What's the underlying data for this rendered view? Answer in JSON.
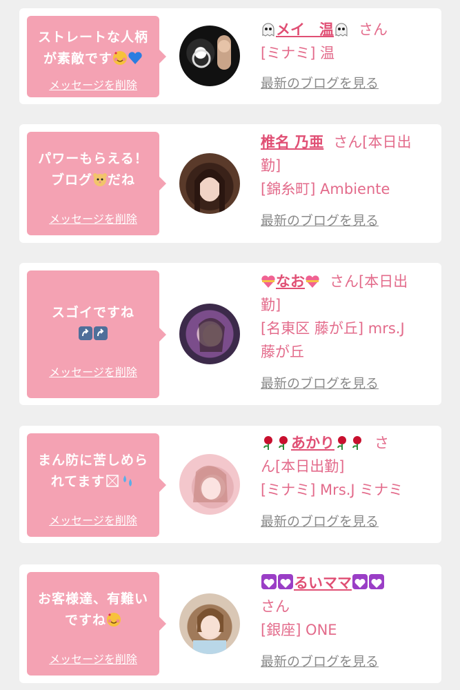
{
  "items": [
    {
      "message_lines": [
        "ストレートな人柄",
        "が素敵です"
      ],
      "message_emoji": [
        "smiling-face-with-hearts-icon",
        "blue-heart-icon"
      ],
      "delete_label": "メッセージを削除",
      "name": "メイ　温",
      "name_emoji": [
        "ghost-icon",
        "ghost-icon"
      ],
      "san_label": "さん",
      "shop_lines": [
        "[ミナミ] 温"
      ],
      "blog_label": "最新のブログを見る"
    },
    {
      "message_lines": [
        "パワーもらえる！",
        "ブログ",
        "だね"
      ],
      "message_emoji": [
        "hamster-face-icon"
      ],
      "delete_label": "メッセージを削除",
      "name": "椎名 乃亜",
      "san_label": "さん[本日出",
      "san_label_2": "勤]",
      "shop_lines": [
        "[錦糸町] Ambiente"
      ],
      "blog_label": "最新のブログを見る"
    },
    {
      "message_lines": [
        "スゴイですね"
      ],
      "message_emoji": [
        "up-arrow-button-icon",
        "up-arrow-button-icon"
      ],
      "delete_label": "メッセージを削除",
      "name": "なお",
      "name_emoji": [
        "heart-with-ribbon-icon",
        "heart-with-ribbon-icon"
      ],
      "san_label": "さん[本日出",
      "san_label_2": "勤]",
      "shop_lines": [
        "[名東区 藤が丘] mrs.J",
        "藤が丘"
      ],
      "blog_label": "最新のブログを見る"
    },
    {
      "message_lines": [
        "まん防に苦しめら",
        "れてます"
      ],
      "message_emoji": [
        "missing-glyph-icon",
        "sweat-droplets-icon"
      ],
      "delete_label": "メッセージを削除",
      "name": "あかり",
      "name_emoji": [
        "rose-icon",
        "rose-icon",
        "rose-icon",
        "rose-icon"
      ],
      "san_label": "さ",
      "san_label_2": "ん[本日出勤]",
      "shop_lines": [
        "[ミナミ] Mrs.J ミナミ"
      ],
      "blog_label": "最新のブログを見る"
    },
    {
      "message_lines": [
        "お客様達、有難い",
        "ですね"
      ],
      "message_emoji": [
        "smiling-face-with-hearts-icon"
      ],
      "delete_label": "メッセージを削除",
      "name": "るいママ",
      "name_emoji": [
        "purple-heart-icon",
        "purple-heart-icon",
        "purple-heart-icon",
        "purple-heart-icon"
      ],
      "san_label": "さん",
      "shop_lines": [
        "[銀座] ONE"
      ],
      "blog_label": "最新のブログを見る"
    }
  ],
  "colors": {
    "page_bg": "#efefef",
    "card_bg": "#ffffff",
    "bubble_bg": "#f4a2b3",
    "name_color": "#e04f74",
    "shop_color": "#e36b8b",
    "link_gray": "#8a8a8a"
  }
}
